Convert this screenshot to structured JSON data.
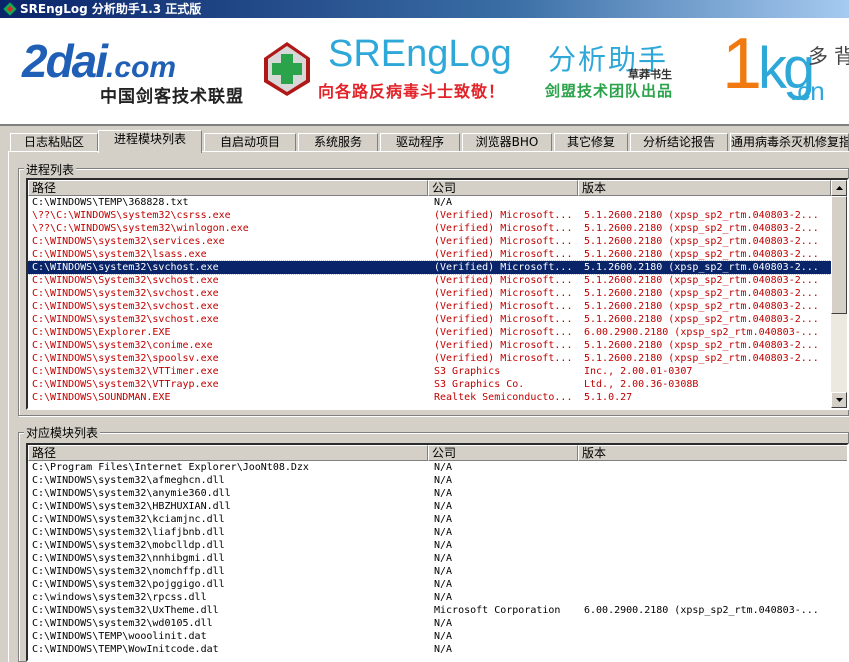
{
  "window": {
    "title": "SREngLog 分析助手1.3 正式版"
  },
  "banner": {
    "logo_main": "2dai",
    "logo_com": ".com",
    "logo_sub": "中国剑客技术联盟",
    "product_name": "SREngLog",
    "product_cn": "分析助手",
    "author": "草莽书生",
    "slogan": "向各路反病毒斗士致敬！",
    "team": "剑盟技术团队出品",
    "logo_1": "1",
    "logo_kg": "kg",
    "logo_cn": ".cn",
    "logo_duobei": "多背"
  },
  "tabs": [
    {
      "label": "日志粘贴区",
      "active": false
    },
    {
      "label": "进程模块列表",
      "active": true
    },
    {
      "label": "自启动项目",
      "active": false
    },
    {
      "label": "系统服务",
      "active": false
    },
    {
      "label": "驱动程序",
      "active": false
    },
    {
      "label": "浏览器BHO",
      "active": false
    },
    {
      "label": "其它修复",
      "active": false
    },
    {
      "label": "分析结论报告",
      "active": false
    },
    {
      "label": "通用病毒杀灭机修复指",
      "active": false
    }
  ],
  "process_group": {
    "label": "进程列表",
    "columns": [
      "路径",
      "公司",
      "版本"
    ],
    "rows": [
      {
        "path": "C:\\WINDOWS\\TEMP\\368828.txt",
        "company": "N/A",
        "version": "",
        "color": "black"
      },
      {
        "path": "\\??\\C:\\WINDOWS\\system32\\csrss.exe",
        "company": "(Verified) Microsoft...",
        "version": "5.1.2600.2180 (xpsp_sp2_rtm.040803-2...",
        "color": "red"
      },
      {
        "path": "\\??\\C:\\WINDOWS\\system32\\winlogon.exe",
        "company": "(Verified) Microsoft...",
        "version": "5.1.2600.2180 (xpsp_sp2_rtm.040803-2...",
        "color": "red"
      },
      {
        "path": "C:\\WINDOWS\\system32\\services.exe",
        "company": "(Verified) Microsoft...",
        "version": "5.1.2600.2180 (xpsp_sp2_rtm.040803-2...",
        "color": "red"
      },
      {
        "path": "C:\\WINDOWS\\system32\\lsass.exe",
        "company": "(Verified) Microsoft...",
        "version": "5.1.2600.2180 (xpsp_sp2_rtm.040803-2...",
        "color": "red"
      },
      {
        "path": "C:\\WINDOWS\\system32\\svchost.exe",
        "company": "(Verified) Microsoft...",
        "version": "5.1.2600.2180 (xpsp_sp2_rtm.040803-2...",
        "color": "red",
        "selected": true
      },
      {
        "path": "C:\\WINDOWS\\System32\\svchost.exe",
        "company": "(Verified) Microsoft...",
        "version": "5.1.2600.2180 (xpsp_sp2_rtm.040803-2...",
        "color": "red"
      },
      {
        "path": "C:\\WINDOWS\\system32\\svchost.exe",
        "company": "(Verified) Microsoft...",
        "version": "5.1.2600.2180 (xpsp_sp2_rtm.040803-2...",
        "color": "red"
      },
      {
        "path": "C:\\WINDOWS\\system32\\svchost.exe",
        "company": "(Verified) Microsoft...",
        "version": "5.1.2600.2180 (xpsp_sp2_rtm.040803-2...",
        "color": "red"
      },
      {
        "path": "C:\\WINDOWS\\system32\\svchost.exe",
        "company": "(Verified) Microsoft...",
        "version": "5.1.2600.2180 (xpsp_sp2_rtm.040803-2...",
        "color": "red"
      },
      {
        "path": "C:\\WINDOWS\\Explorer.EXE",
        "company": "(Verified) Microsoft...",
        "version": "6.00.2900.2180 (xpsp_sp2_rtm.040803-...",
        "color": "red"
      },
      {
        "path": "C:\\WINDOWS\\system32\\conime.exe",
        "company": "(Verified) Microsoft...",
        "version": "5.1.2600.2180 (xpsp_sp2_rtm.040803-2...",
        "color": "red"
      },
      {
        "path": "C:\\WINDOWS\\system32\\spoolsv.exe",
        "company": "(Verified) Microsoft...",
        "version": "5.1.2600.2180 (xpsp_sp2_rtm.040803-2...",
        "color": "red"
      },
      {
        "path": "C:\\WINDOWS\\system32\\VTTimer.exe",
        "company": "S3 Graphics",
        "version": "Inc., 2.00.01-0307",
        "color": "red"
      },
      {
        "path": "C:\\WINDOWS\\system32\\VTTrayp.exe",
        "company": "S3 Graphics Co.",
        "version": "Ltd., 2.00.36-0308B",
        "color": "red"
      },
      {
        "path": "C:\\WINDOWS\\SOUNDMAN.EXE",
        "company": "Realtek Semiconducto...",
        "version": "5.1.0.27",
        "color": "red"
      }
    ]
  },
  "module_group": {
    "label": "对应模块列表",
    "columns": [
      "路径",
      "公司",
      "版本"
    ],
    "rows": [
      {
        "path": "C:\\Program Files\\Internet Explorer\\JooNt08.Dzx",
        "company": "N/A",
        "version": ""
      },
      {
        "path": "C:\\WINDOWS\\system32\\afmeghcn.dll",
        "company": "N/A",
        "version": ""
      },
      {
        "path": "C:\\WINDOWS\\system32\\anymie360.dll",
        "company": "N/A",
        "version": ""
      },
      {
        "path": "C:\\WINDOWS\\system32\\HBZHUXIAN.dll",
        "company": "N/A",
        "version": ""
      },
      {
        "path": "C:\\WINDOWS\\system32\\kciamjnc.dll",
        "company": "N/A",
        "version": ""
      },
      {
        "path": "C:\\WINDOWS\\system32\\liafjbnb.dll",
        "company": "N/A",
        "version": ""
      },
      {
        "path": "C:\\WINDOWS\\system32\\mobclldp.dll",
        "company": "N/A",
        "version": ""
      },
      {
        "path": "C:\\WINDOWS\\system32\\nnhibgmi.dll",
        "company": "N/A",
        "version": ""
      },
      {
        "path": "C:\\WINDOWS\\system32\\nomchffp.dll",
        "company": "N/A",
        "version": ""
      },
      {
        "path": "C:\\WINDOWS\\system32\\pojggigo.dll",
        "company": "N/A",
        "version": ""
      },
      {
        "path": "c:\\windows\\system32\\rpcss.dll",
        "company": "N/A",
        "version": ""
      },
      {
        "path": "C:\\WINDOWS\\system32\\UxTheme.dll",
        "company": "Microsoft Corporation",
        "version": "6.00.2900.2180 (xpsp_sp2_rtm.040803-..."
      },
      {
        "path": "C:\\WINDOWS\\system32\\wd0105.dll",
        "company": "N/A",
        "version": ""
      },
      {
        "path": "C:\\WINDOWS\\TEMP\\wooolinit.dat",
        "company": "N/A",
        "version": ""
      },
      {
        "path": "C:\\WINDOWS\\TEMP\\WowInitcode.dat",
        "company": "N/A",
        "version": ""
      }
    ]
  },
  "colors": {
    "highlight": "#0a246a",
    "flagged_text": "#c00000",
    "window_bg": "#d4d0c8"
  }
}
